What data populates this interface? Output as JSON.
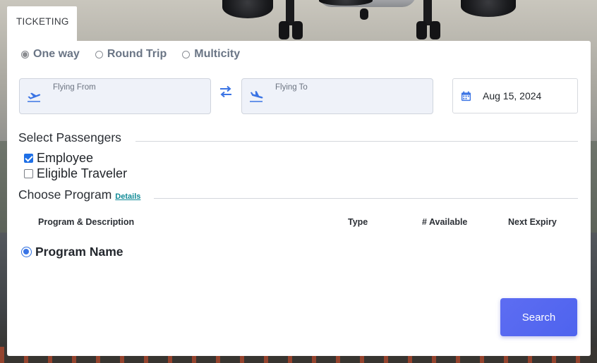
{
  "tab": {
    "label": "TICKETING"
  },
  "trip_types": [
    {
      "label": "One way",
      "checked": true
    },
    {
      "label": "Round Trip",
      "checked": false
    },
    {
      "label": "Multicity",
      "checked": false
    }
  ],
  "from_field": {
    "label": "Flying From",
    "icon": "plane-departure-icon"
  },
  "to_field": {
    "label": "Flying To",
    "icon": "plane-arrival-icon"
  },
  "swap": {
    "icon": "swap-arrows-icon"
  },
  "date": {
    "value": "Aug 15, 2024",
    "icon": "calendar-icon"
  },
  "passengers": {
    "title": "Select Passengers",
    "options": [
      {
        "label": "Employee",
        "checked": true
      },
      {
        "label": "Eligible Traveler",
        "checked": false
      }
    ]
  },
  "program": {
    "title": "Choose Program",
    "details_link": "Details",
    "columns": [
      "Program & Description",
      "Type",
      "# Available",
      "Next Expiry"
    ],
    "rows": [
      {
        "name": "Program Name",
        "selected": true
      }
    ]
  },
  "search_button": {
    "label": "Search"
  },
  "colors": {
    "accent": "#4e63ee",
    "checkbox": "#1e6fe6",
    "link": "#0f8a96",
    "field_bg": "#eff2f9"
  }
}
